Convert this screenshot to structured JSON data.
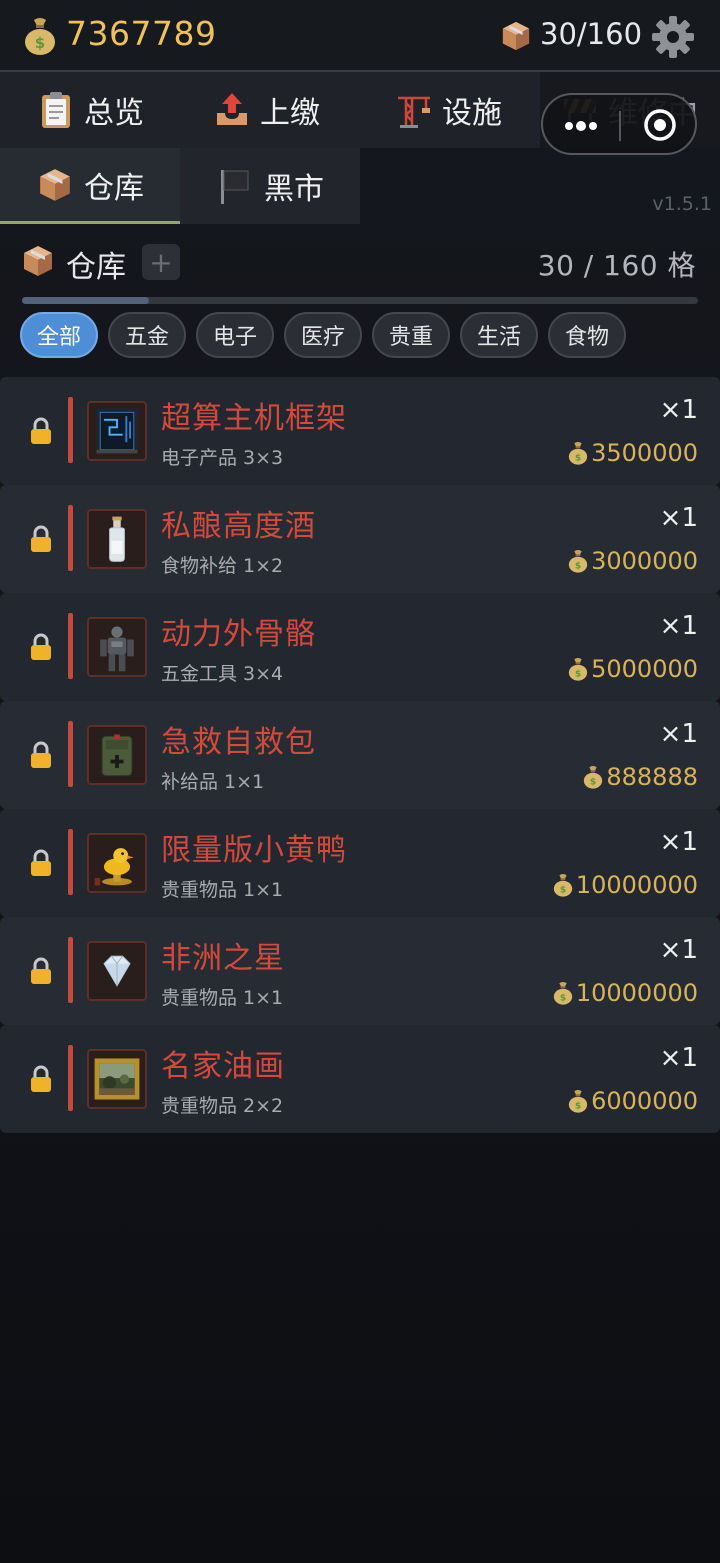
{
  "header": {
    "money": "7367789",
    "capacity": "30/160"
  },
  "nav": {
    "tabs": [
      {
        "label": "总览",
        "icon": "clipboard-icon"
      },
      {
        "label": "上缴",
        "icon": "upload-tray-icon"
      },
      {
        "label": "设施",
        "icon": "crane-icon"
      },
      {
        "label": "维修中",
        "icon": "construction-barrier-icon"
      }
    ],
    "subtabs": [
      {
        "label": "仓库",
        "icon": "box-icon",
        "active": true
      },
      {
        "label": "黑市",
        "icon": "black-flag-icon",
        "active": false
      }
    ]
  },
  "version": "v1.5.1",
  "warehouse": {
    "title": "仓库",
    "add_label": "+",
    "count_text": "30 / 160 格",
    "used": 30,
    "total": 160
  },
  "filters": [
    "全部",
    "五金",
    "电子",
    "医疗",
    "贵重",
    "生活",
    "食物"
  ],
  "active_filter": "全部",
  "items": [
    {
      "name": "超算主机框架",
      "sub": "电子产品 3×3",
      "qty": "×1",
      "price": "3500000",
      "icon": "server-rack-icon",
      "locked": true
    },
    {
      "name": "私酿高度酒",
      "sub": "食物补给 1×2",
      "qty": "×1",
      "price": "3000000",
      "icon": "liquor-bottle-icon",
      "locked": true
    },
    {
      "name": "动力外骨骼",
      "sub": "五金工具 3×4",
      "qty": "×1",
      "price": "5000000",
      "icon": "exoskeleton-icon",
      "locked": true
    },
    {
      "name": "急救自救包",
      "sub": "补给品 1×1",
      "qty": "×1",
      "price": "888888",
      "icon": "first-aid-pouch-icon",
      "locked": true
    },
    {
      "name": "限量版小黄鸭",
      "sub": "贵重物品 1×1",
      "qty": "×1",
      "price": "10000000",
      "icon": "golden-duck-icon",
      "locked": true
    },
    {
      "name": "非洲之星",
      "sub": "贵重物品 1×1",
      "qty": "×1",
      "price": "10000000",
      "icon": "diamond-icon",
      "locked": true
    },
    {
      "name": "名家油画",
      "sub": "贵重物品 2×2",
      "qty": "×1",
      "price": "6000000",
      "icon": "framed-painting-icon",
      "locked": true
    }
  ],
  "colors": {
    "gold": "#efc15a",
    "item_name": "#d24a3c",
    "accent_bar": "#c34a3c",
    "chip_active": "#4d8ed6",
    "subtab_underline": "#8fa673"
  }
}
